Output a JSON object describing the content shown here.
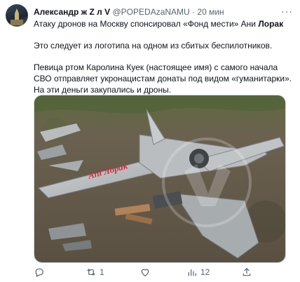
{
  "tweet": {
    "author_name": "Александр ж Z л V",
    "handle": "@POPEDAzaNAMU",
    "separator": "·",
    "time": "20 мин",
    "line1_text": "Атаку дронов на Москву спонсировал «Фонд мести» Ани ",
    "line1_bold": "Лорак",
    "paragraph2": "Это следует из логотипа на одном из сбитых беспилотников.",
    "paragraph3": "Певица ртом Каролина Куек (настоящее имя) с самого начала СВО отправляет укронацистам донаты под видом «гуманитарки». На эти деньги закупались и дроны.",
    "more_icon": "more-dots-icon"
  },
  "photo": {
    "logo_text": "Ani Лорак",
    "colors": {
      "ground": "#6b6150",
      "grass": "#5a6a3a",
      "drone": "#c4c7c9",
      "logo": "#d8283a"
    }
  },
  "actions": {
    "reply": {
      "icon": "reply-icon",
      "count": ""
    },
    "retweet": {
      "icon": "retweet-icon",
      "count": "1"
    },
    "like": {
      "icon": "like-icon",
      "count": ""
    },
    "views": {
      "icon": "views-icon",
      "count": "12"
    },
    "share": {
      "icon": "share-icon",
      "count": ""
    }
  }
}
